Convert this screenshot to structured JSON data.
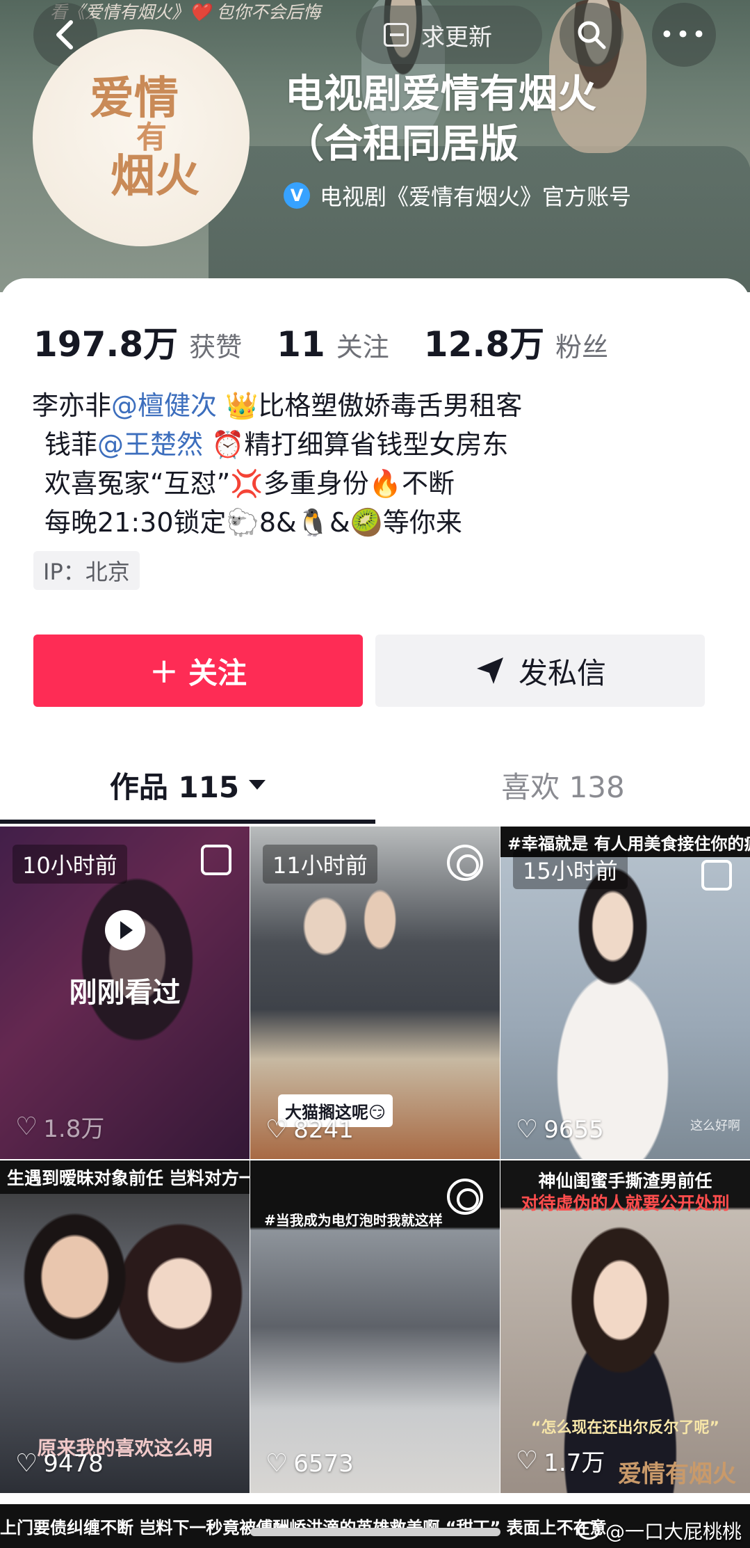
{
  "header": {
    "top_caption": "看《爱情有烟火》❤️ 包你不会后悔",
    "update_label": "求更新",
    "back_icon": "chevron-left-icon",
    "search_icon": "search-icon",
    "more_icon": "more-icon",
    "more_glyph": "•••",
    "avatar_logo": [
      "爱情",
      "有",
      "烟火"
    ],
    "account_name_line1": "电视剧爱情有烟火",
    "account_name_line2": "（合租同居版",
    "verified_label": "电视剧《爱情有烟火》官方账号",
    "verified_badge": "V"
  },
  "stats": {
    "likes_num": "197.8万",
    "likes_label": "获赞",
    "following_num": "11",
    "following_label": "关注",
    "fans_num": "12.8万",
    "fans_label": "粉丝"
  },
  "bio": {
    "line1_prefix": "李亦非",
    "line1_mention": "@檀健次",
    "line1_suffix": " 👑比格塑傲娇毒舌男租客",
    "line2_prefix": "钱菲",
    "line2_mention": "@王楚然",
    "line2_suffix": " ⏰精打细算省钱型女房东",
    "line3": "欢喜冤家“互怼”💢多重身份🔥不断",
    "line4": "每晚21:30锁定🐑8&🐧&🥝等你来",
    "ip": "IP：北京"
  },
  "actions": {
    "follow_plus": "+",
    "follow_label": "关注",
    "message_label": "发私信"
  },
  "tabs": {
    "works": "作品 115",
    "likes": "喜欢 138"
  },
  "videos": [
    {
      "time": "10小时前",
      "likes": "1.8万",
      "overlay": "刚刚看过",
      "icon": "multi-image-icon"
    },
    {
      "time": "11小时前",
      "likes": "8241",
      "sticker": "大猫搁这呢😏",
      "icon": "live-ring-icon"
    },
    {
      "time": "15小时前",
      "likes": "9655",
      "top_caption": "#幸福就是 有人用美食接住你的疲惫",
      "icon": "multi-image-icon",
      "corner_text": "这么好啊"
    },
    {
      "likes": "9478",
      "top_caption": "生遇到暧昧对象前任 岂料对方一眼",
      "sub_caption": "原来我的喜欢这么明"
    },
    {
      "likes": "6573",
      "top_caption": "#当我成为电灯泡时我就这样",
      "icon": "live-ring-icon"
    },
    {
      "likes": "1.7万",
      "top_caption": "神仙闺蜜手撕渣男前任",
      "top_caption2": "对待虚伪的人就要公开处刑",
      "sub_caption": "“怎么现在还出尔反尔了呢”",
      "logo_text": "爱情有烟火"
    }
  ],
  "bottom_strip": "上门要债纠缠不断  岂料下一秒竟被傅酬峤洪滴的英雄救美啊            “甜丁” 表面上不在意",
  "watermark": "@一口大屁桃桃",
  "colors": {
    "accent": "#fe2c55",
    "mention": "#3c6ebd",
    "verified": "#37a2ff"
  }
}
